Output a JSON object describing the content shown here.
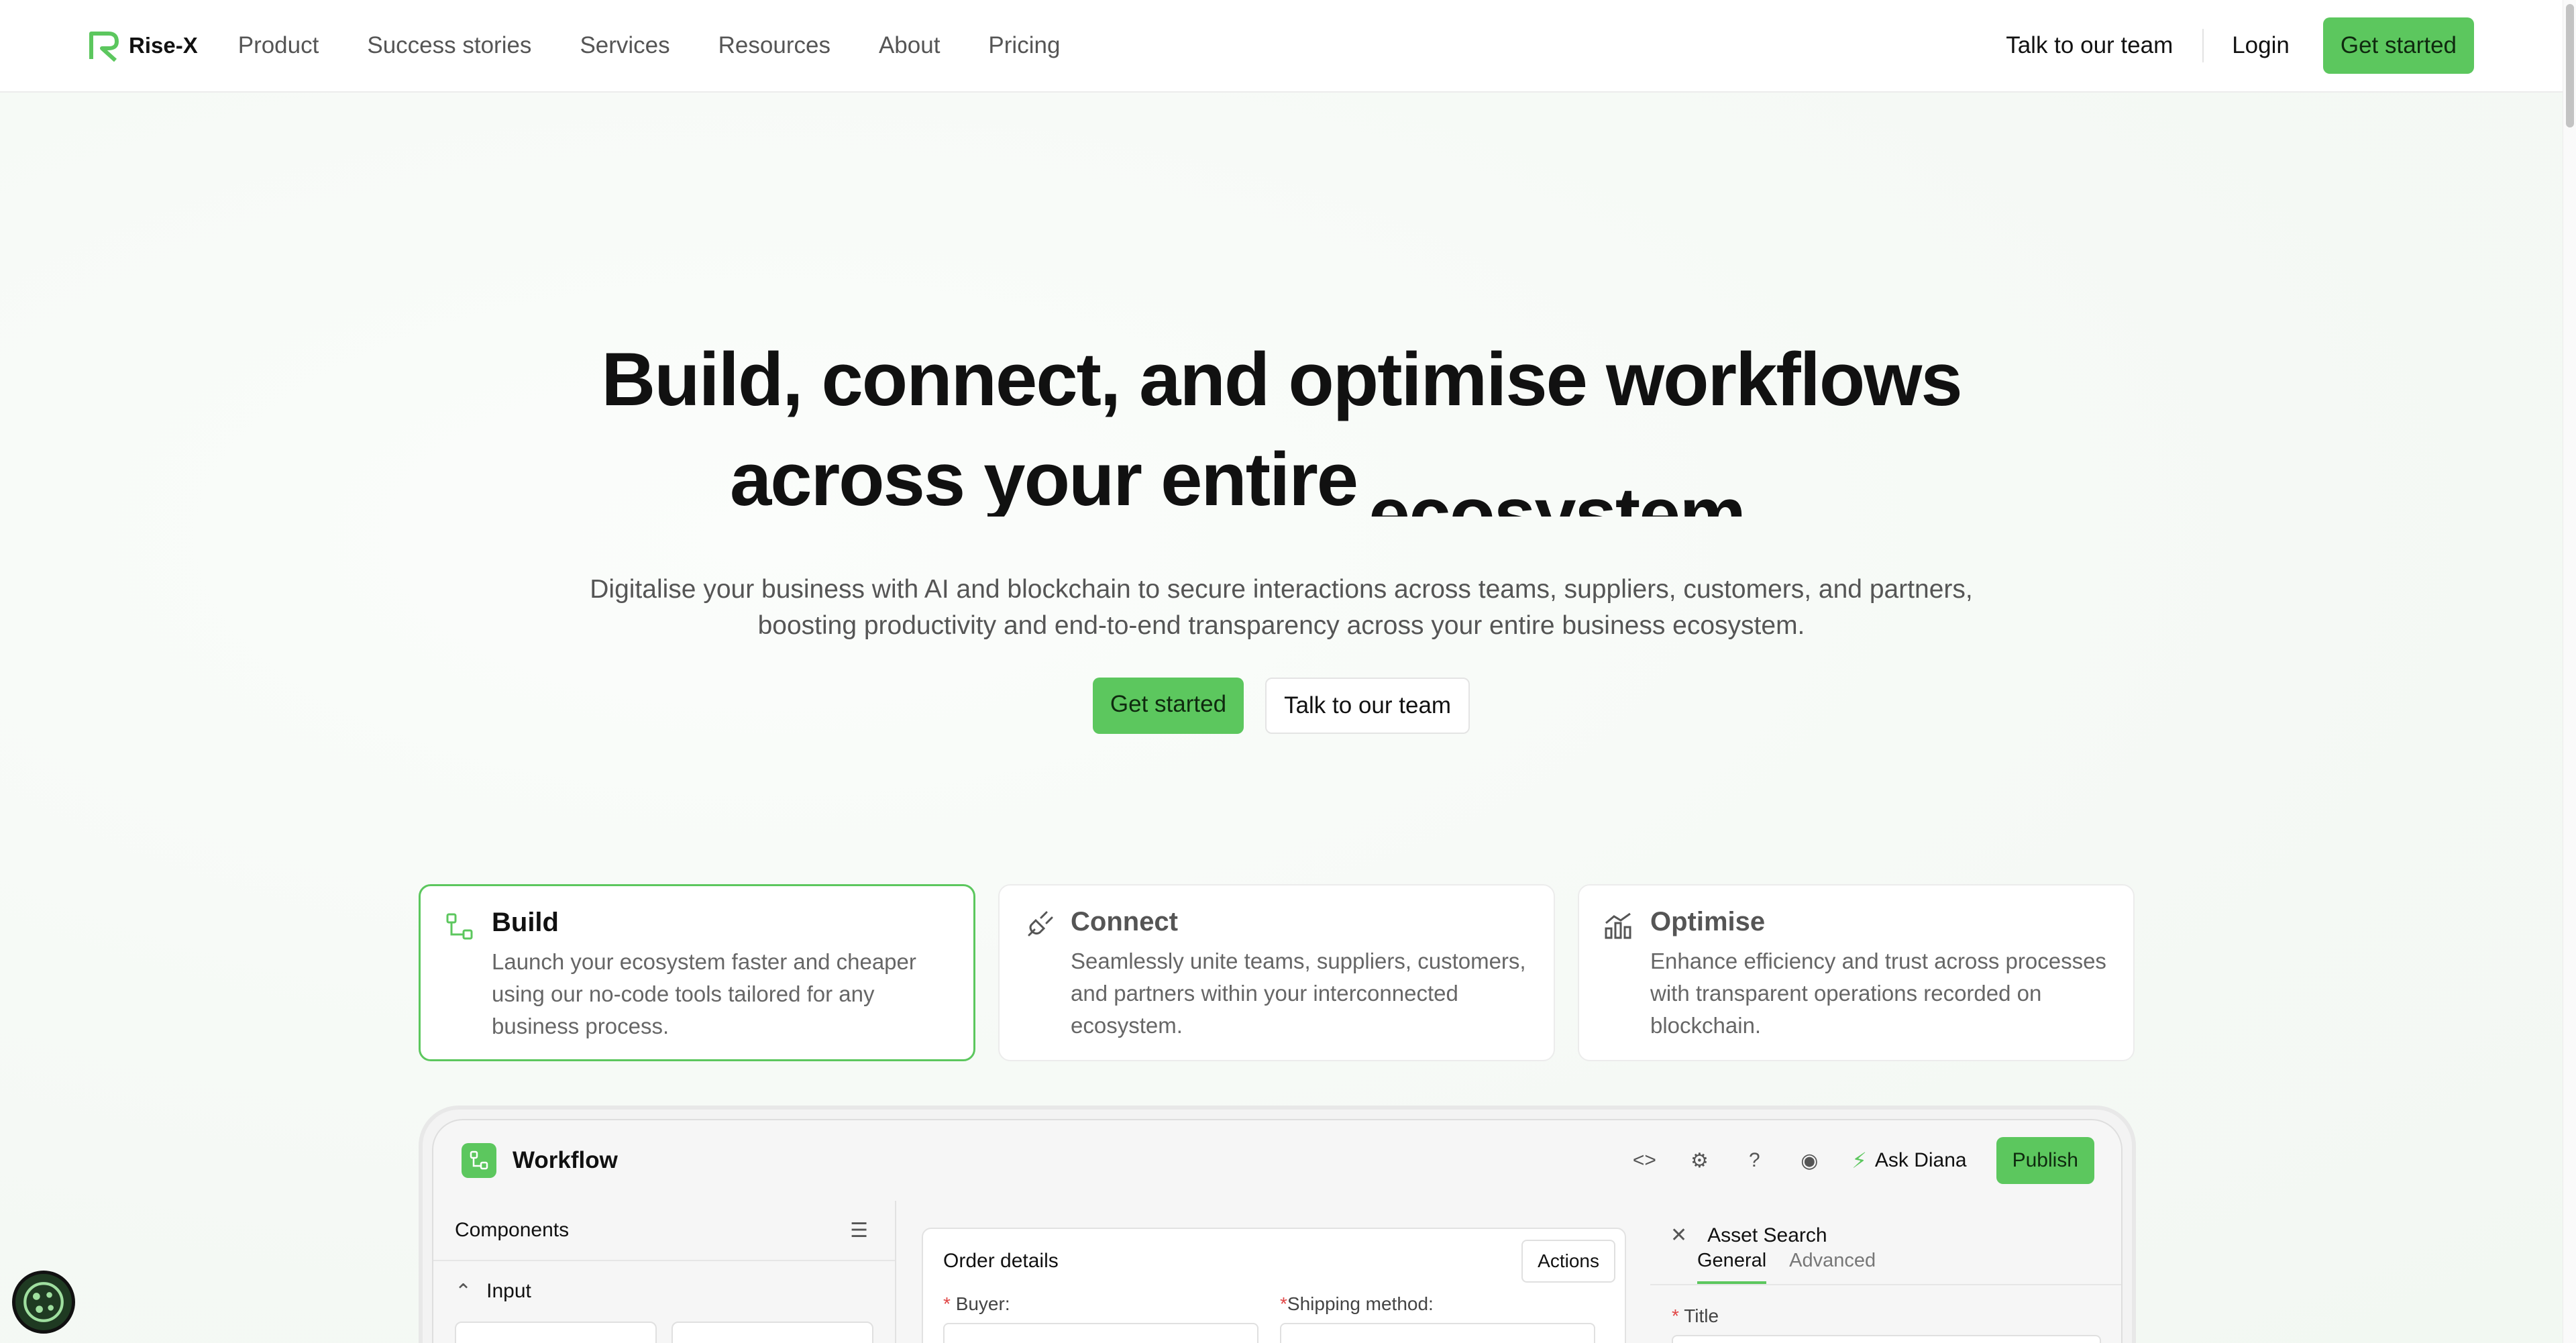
{
  "brand": {
    "name": "Rise-X",
    "accent": "#5cc75e"
  },
  "nav": {
    "links": [
      "Product",
      "Success stories",
      "Services",
      "Resources",
      "About",
      "Pricing"
    ],
    "talk": "Talk to our team",
    "login": "Login",
    "get_started": "Get started"
  },
  "hero": {
    "title_line1": "Build, connect, and optimise workflows",
    "title_line2a": "across your entire",
    "title_line2b": "ecosystem",
    "subtitle_line1": "Digitalise your business with AI and blockchain to secure interactions across teams, suppliers, customers, and partners,",
    "subtitle_line2": "boosting productivity and end-to-end transparency across your entire business ecosystem.",
    "cta_primary": "Get started",
    "cta_secondary": "Talk to our team"
  },
  "features": [
    {
      "title": "Build",
      "text": "Launch your ecosystem faster and cheaper using our no-code tools tailored for any business process.",
      "icon": "workflow-icon",
      "active": true
    },
    {
      "title": "Connect",
      "text": "Seamlessly unite teams, suppliers, customers, and partners within your interconnected ecosystem.",
      "icon": "plug-icon",
      "active": false
    },
    {
      "title": "Optimise",
      "text": "Enhance efficiency and trust across processes with transparent operations recorded on blockchain.",
      "icon": "chart-growth-icon",
      "active": false
    }
  ],
  "app": {
    "title": "Workflow",
    "ask": "Ask Diana",
    "publish": "Publish",
    "components_title": "Components",
    "input_group": "Input",
    "order_title": "Order details",
    "actions": "Actions",
    "buyer_label": "Buyer:",
    "shipping_label": "Shipping method:",
    "asset_title": "Asset Search",
    "tab_general": "General",
    "tab_advanced": "Advanced",
    "title_field": "Title"
  }
}
